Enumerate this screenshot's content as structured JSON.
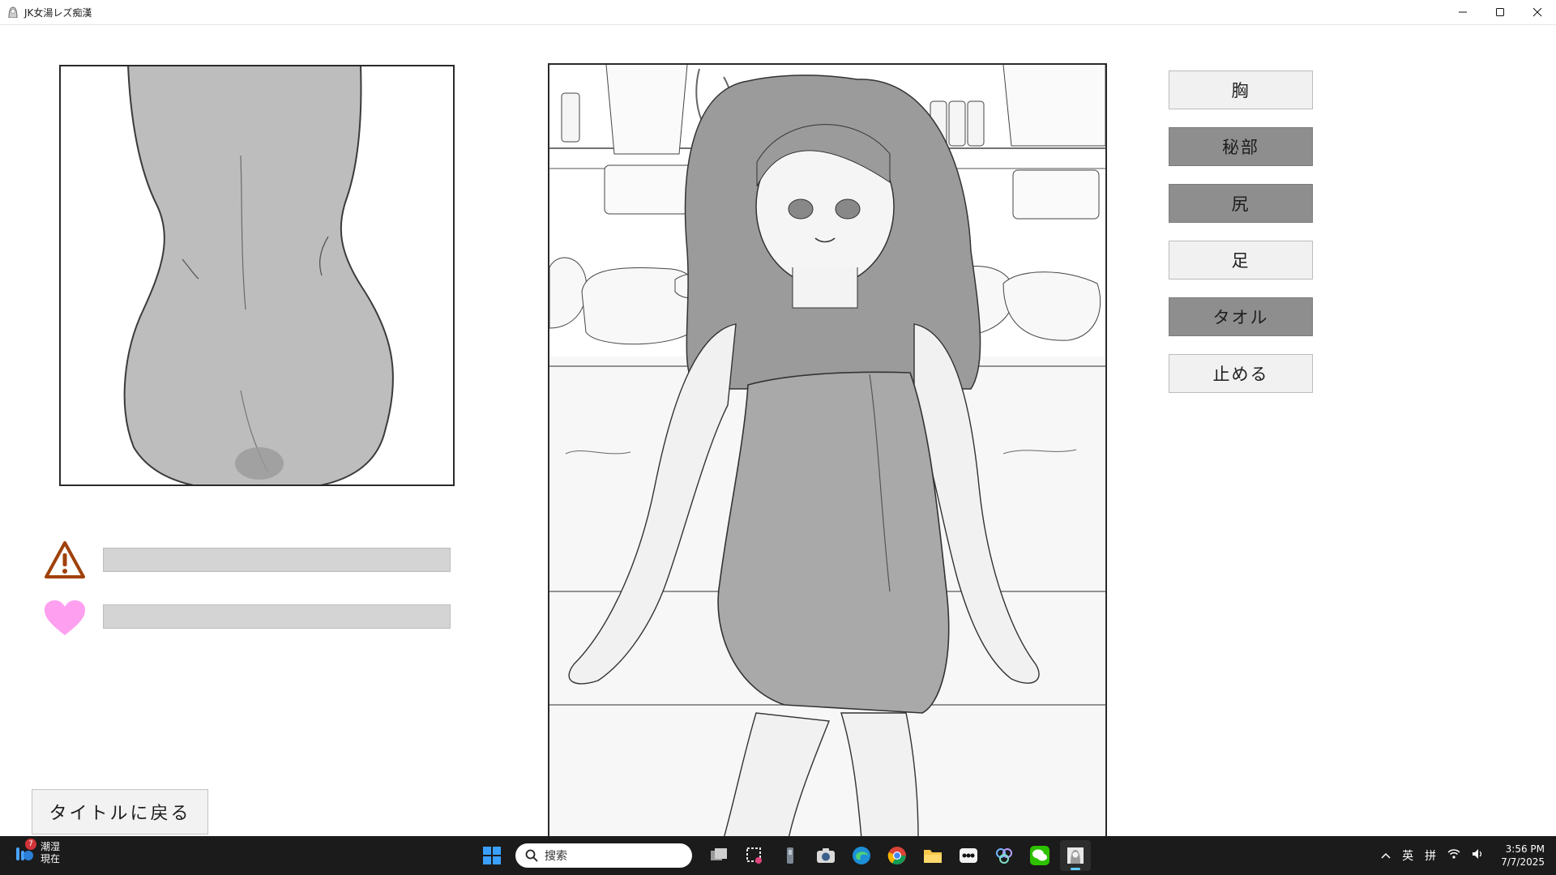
{
  "window": {
    "title": "JK女湯レズ痴漢",
    "icon": "girl-avatar-icon"
  },
  "preview": {
    "focus_part": "尻"
  },
  "status": {
    "danger_icon": "warning-icon",
    "danger_level": 0,
    "pleasure_icon": "heart-icon",
    "pleasure_level": 0,
    "colors": {
      "danger": "#a0410a",
      "pleasure": "#ff9ff0",
      "track": "#d4d4d4"
    }
  },
  "actions": [
    {
      "label": "胸",
      "state": "normal"
    },
    {
      "label": "秘部",
      "state": "disabled"
    },
    {
      "label": "尻",
      "state": "disabled"
    },
    {
      "label": "足",
      "state": "normal"
    },
    {
      "label": "タオル",
      "state": "disabled"
    },
    {
      "label": "止める",
      "state": "normal"
    }
  ],
  "back_button": {
    "label": "タイトルに戻る"
  },
  "taskbar": {
    "weather": {
      "badge": "7",
      "condition": "潮湿",
      "time_label": "現在"
    },
    "search_placeholder": "搜索",
    "tray": {
      "ime_lang": "英",
      "ime_mode": "拼"
    },
    "clock": {
      "time": "3:56 PM",
      "date": "7/7/2025"
    }
  }
}
